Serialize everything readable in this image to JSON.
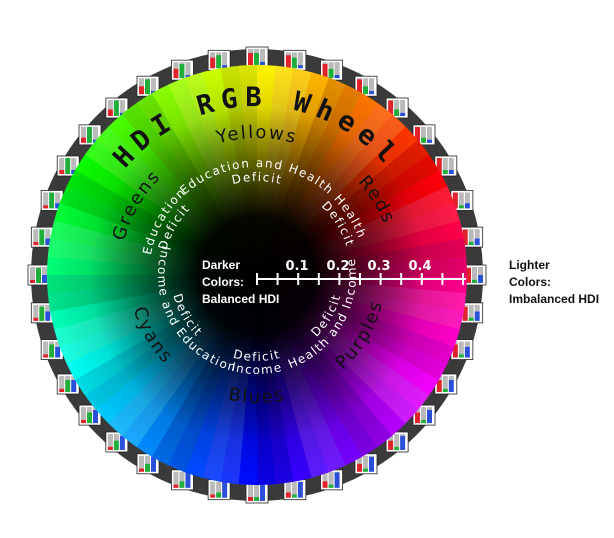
{
  "title": "HDI RGB Wheel",
  "sectors": {
    "yellows": "Yellows",
    "reds": "Reds",
    "purples": "Purples",
    "blues": "Blues",
    "cyans": "Cyans",
    "greens": "Greens"
  },
  "deficits": {
    "education_health": [
      "Education and Health",
      "Deficit"
    ],
    "health": [
      "Health",
      "Deficit"
    ],
    "health_income": [
      "Health and Income",
      "Deficit"
    ],
    "income": [
      "Income",
      "Deficit"
    ],
    "income_education": [
      "Income and Education",
      "Deficit"
    ],
    "education": [
      "Education",
      "Deficit"
    ]
  },
  "scale": {
    "ticks": [
      "0.1",
      "0.2",
      "0.3",
      "0.4"
    ],
    "left_label": [
      "Darker",
      "Colors:",
      "Balanced HDI"
    ],
    "right_label": [
      "Lighter",
      "Colors:",
      "Imbalanced HDI"
    ]
  },
  "colors": {
    "ring": "#3a3a3a",
    "center": "#000000",
    "scale_line": "#ffffff",
    "title": "#111111",
    "sector_text": "#111111",
    "deficit_text": "#ffffff"
  },
  "swatch_icon": "rgb-bar-icon",
  "swatch_count": 36
}
